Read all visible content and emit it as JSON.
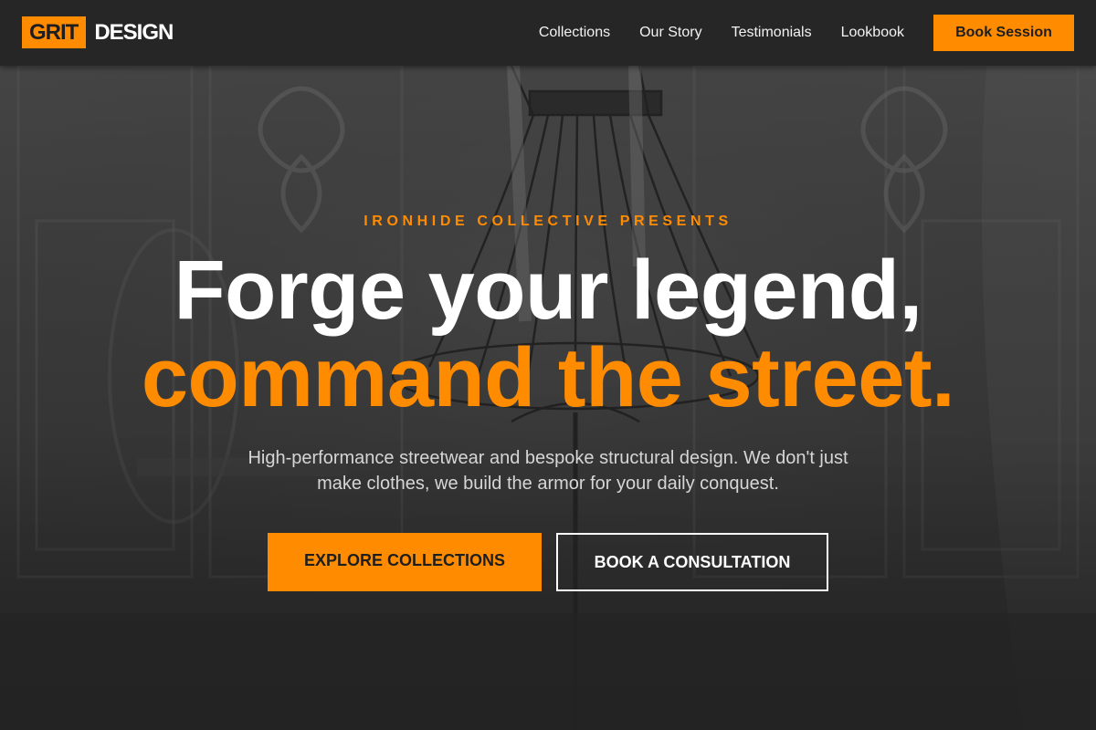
{
  "brand": {
    "badge": "GRIT",
    "word": "DESIGN",
    "accent_color": "#ff8c00"
  },
  "nav": {
    "links": [
      "Collections",
      "Our Story",
      "Testimonials",
      "Lookbook"
    ],
    "cta": "Book Session"
  },
  "hero": {
    "eyebrow": "IRONHIDE COLLECTIVE PRESENTS",
    "headline_line1": "Forge your legend,",
    "headline_line2": "command the street.",
    "subtext": "High-performance streetwear and bespoke structural design. We don't just make clothes, we build the armor for your daily conquest.",
    "primary_button": "EXPLORE COLLECTIONS",
    "secondary_button": "BOOK A CONSULTATION",
    "background_image": "dress-form-mannequin-in-atelier"
  }
}
